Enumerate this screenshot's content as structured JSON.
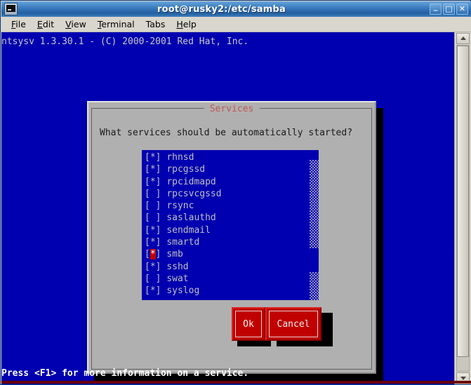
{
  "window": {
    "title": "root@rusky2:/etc/samba",
    "icon": "terminal-icon",
    "controls": {
      "minimize": "_",
      "maximize": "□",
      "close": "✕"
    }
  },
  "menubar": {
    "items": [
      {
        "label": "File",
        "mnemonic": "F",
        "rest": "ile"
      },
      {
        "label": "Edit",
        "mnemonic": "E",
        "rest": "dit"
      },
      {
        "label": "View",
        "mnemonic": "V",
        "rest": "iew"
      },
      {
        "label": "Terminal",
        "mnemonic": "T",
        "rest": "erminal"
      },
      {
        "label": "Tabs",
        "mnemonic": "",
        "rest": "Tabs"
      },
      {
        "label": "Help",
        "mnemonic": "H",
        "rest": "elp"
      }
    ]
  },
  "terminal": {
    "header_line": "ntsysv 1.3.30.1 - (C) 2000-2001 Red Hat, Inc.",
    "status_line": "Press <F1> for more information on a service.",
    "background_color": "#0000b0",
    "text_color": "#c8c8c8"
  },
  "dialog": {
    "title": "Services",
    "title_color": "#c05858",
    "prompt": "What services should be automatically started?",
    "services": [
      {
        "name": "rhnsd",
        "checked": true,
        "mark": "[*]",
        "cursor": false
      },
      {
        "name": "rpcgssd",
        "checked": true,
        "mark": "[*]",
        "cursor": false
      },
      {
        "name": "rpcidmapd",
        "checked": true,
        "mark": "[*]",
        "cursor": false
      },
      {
        "name": "rpcsvcgssd",
        "checked": false,
        "mark": "[ ]",
        "cursor": false
      },
      {
        "name": "rsync",
        "checked": false,
        "mark": "[ ]",
        "cursor": false
      },
      {
        "name": "saslauthd",
        "checked": false,
        "mark": "[ ]",
        "cursor": false
      },
      {
        "name": "sendmail",
        "checked": true,
        "mark": "[*]",
        "cursor": false
      },
      {
        "name": "smartd",
        "checked": true,
        "mark": "[*]",
        "cursor": false
      },
      {
        "name": "smb",
        "checked": true,
        "mark": "[*]",
        "cursor": true
      },
      {
        "name": "sshd",
        "checked": true,
        "mark": "[*]",
        "cursor": false
      },
      {
        "name": "swat",
        "checked": false,
        "mark": "[ ]",
        "cursor": false
      },
      {
        "name": "syslog",
        "checked": true,
        "mark": "[*]",
        "cursor": false
      }
    ],
    "buttons": {
      "ok": "Ok",
      "cancel": "Cancel"
    },
    "button_color": "#c00000",
    "list_background": "#0000b0"
  }
}
